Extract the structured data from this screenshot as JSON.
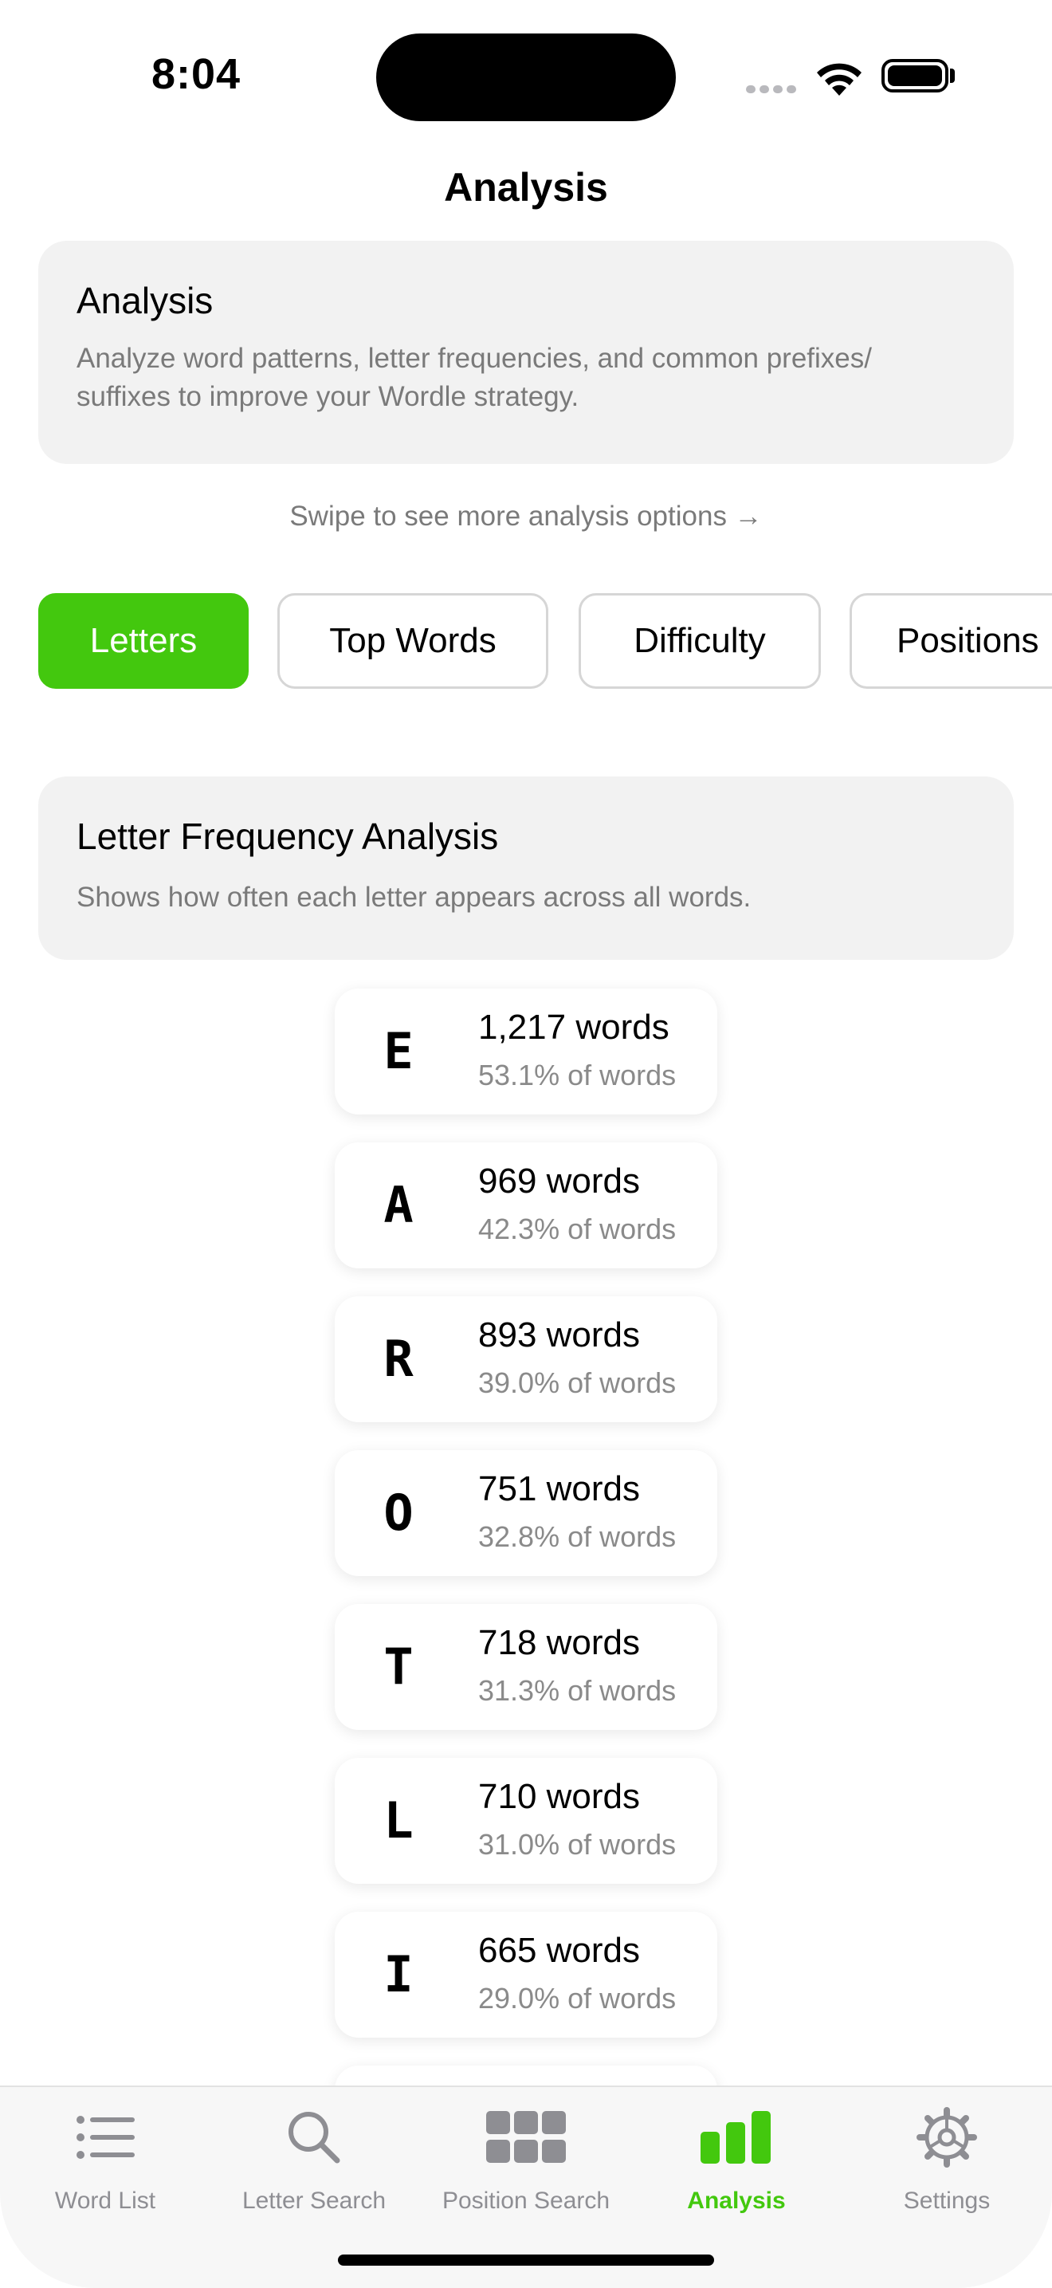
{
  "status": {
    "time": "8:04"
  },
  "nav": {
    "title": "Analysis"
  },
  "intro": {
    "title": "Analysis",
    "description_line1": "Analyze word patterns, letter frequencies, and common prefixes/",
    "description_line2": "suffixes to improve your Wordle strategy."
  },
  "swipe_hint": "Swipe to see more analysis options →",
  "tabs": [
    {
      "label": "Letters",
      "active": true
    },
    {
      "label": "Top Words",
      "active": false
    },
    {
      "label": "Difficulty",
      "active": false
    },
    {
      "label": "Positions",
      "active": false
    }
  ],
  "frequency": {
    "title": "Letter Frequency Analysis",
    "description": "Shows how often each letter appears across all words.",
    "items": [
      {
        "letter": "E",
        "count": "1,217 words",
        "pct": "53.1% of words"
      },
      {
        "letter": "A",
        "count": "969 words",
        "pct": "42.3% of words"
      },
      {
        "letter": "R",
        "count": "893 words",
        "pct": "39.0% of words"
      },
      {
        "letter": "O",
        "count": "751 words",
        "pct": "32.8% of words"
      },
      {
        "letter": "T",
        "count": "718 words",
        "pct": "31.3% of words"
      },
      {
        "letter": "L",
        "count": "710 words",
        "pct": "31.0% of words"
      },
      {
        "letter": "I",
        "count": "665 words",
        "pct": "29.0% of words"
      }
    ]
  },
  "tabbar": [
    {
      "label": "Word List",
      "icon": "list-icon"
    },
    {
      "label": "Letter Search",
      "icon": "magnifier-icon"
    },
    {
      "label": "Position Search",
      "icon": "grid-icon"
    },
    {
      "label": "Analysis",
      "icon": "bar-chart-icon",
      "active": true
    },
    {
      "label": "Settings",
      "icon": "gear-icon"
    }
  ],
  "colors": {
    "accent": "#43c80e",
    "card_bg": "#f2f2f2",
    "secondary_text": "#7a7a7a"
  }
}
